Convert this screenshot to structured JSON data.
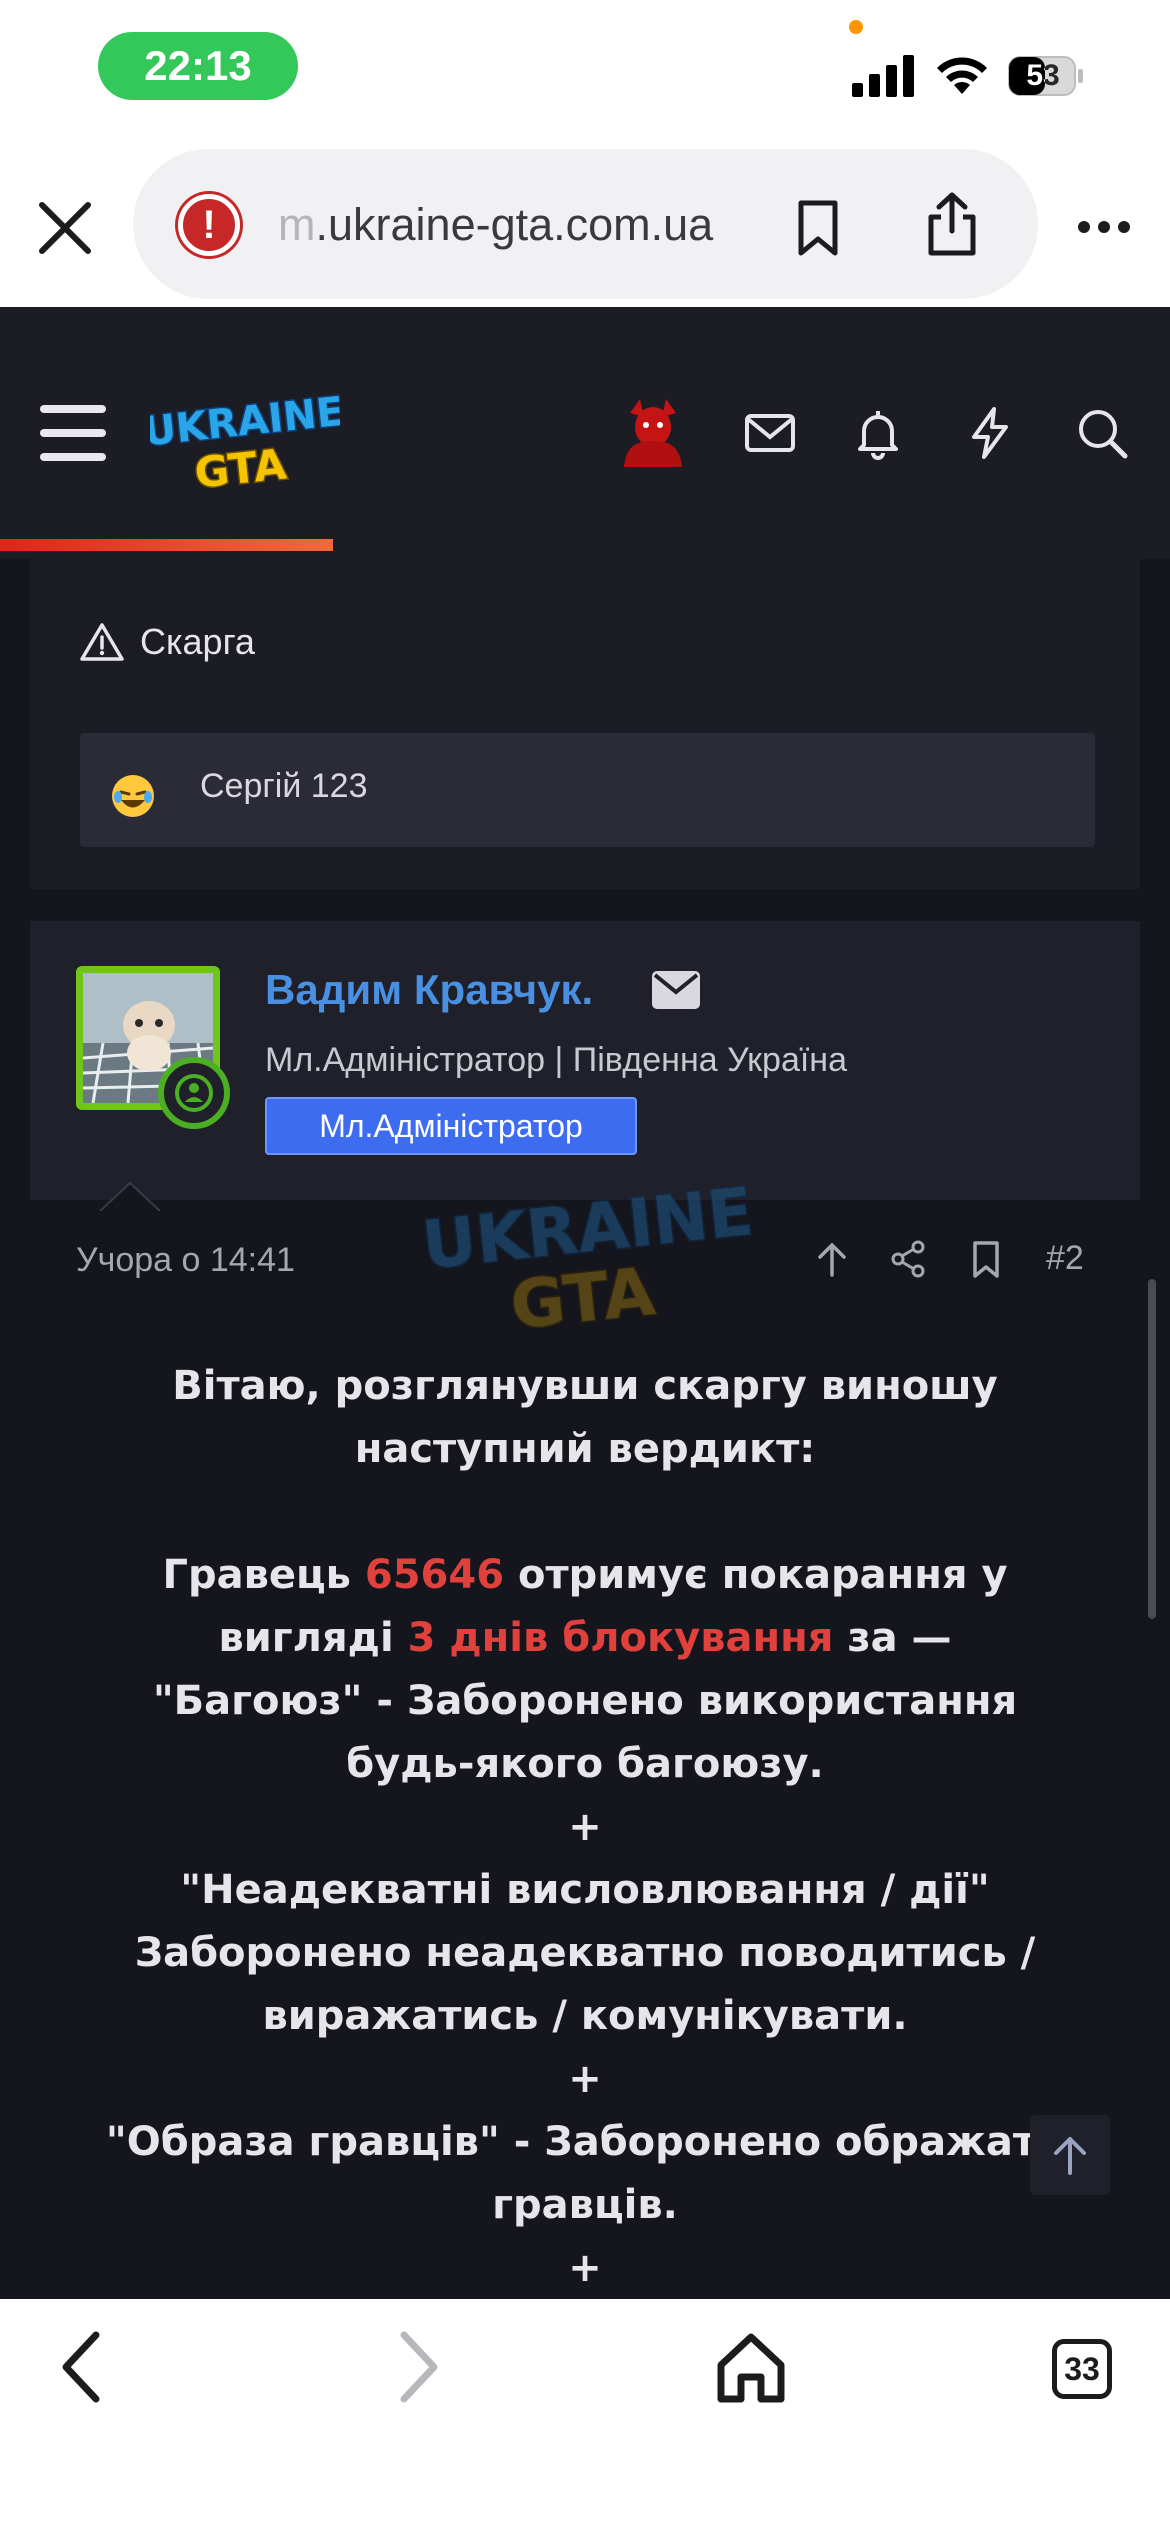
{
  "status_bar": {
    "time": "22:13",
    "battery": "53"
  },
  "browser": {
    "url_faded": "m",
    "url_main": ".ukraine-gta.com.ua",
    "warning_glyph": "!",
    "tabs_count": "33"
  },
  "site": {
    "logo_text": "UKRAINE GTA",
    "progress": 0.285
  },
  "complaint": {
    "label": "Скарга",
    "mention": "Сергій 123"
  },
  "post": {
    "author": "Вадим Кравчук.",
    "role_line": "Мл.Адміністратор | Південна Україна",
    "badge": "Мл.Адміністратор",
    "date": "Учора о 14:41",
    "number": "#2",
    "body": {
      "l1": "Вітаю, розглянувши скаргу виношу",
      "l2": "наступний вердикт:",
      "l3_a": "Гравець ",
      "l3_b": "65646",
      "l3_c": " отримує покарання у",
      "l4_a": "вигляді ",
      "l4_b": "3 днів блокування",
      "l4_c": " за —",
      "l5": "\"Багоюз\" - Заборонено використання",
      "l6": "будь-якого багоюзу.",
      "plus": "+",
      "l7": "\"Неадекватні висловлювання / дії\"",
      "l8": "Заборонено неадекватно поводитись /",
      "l9": "виражатись / комунікувати.",
      "l10": "\"Образа гравців\" - Заборонено ображати",
      "l11": "гравців."
    }
  },
  "icons": {
    "close": "close-icon",
    "bookmark": "bookmark-icon",
    "share": "share-icon",
    "more": "ellipsis-icon",
    "menu": "hamburger-icon",
    "mail": "envelope-icon",
    "bell": "bell-icon",
    "bolt": "lightning-icon",
    "search": "search-icon"
  },
  "colors": {
    "accent_green": "#34c759",
    "site_dark": "#1b1c24",
    "author_blue": "#4a90e2",
    "badge_blue": "#3d6cf0",
    "highlight_red": "#e0413c",
    "progress_red": "#e2231a"
  }
}
